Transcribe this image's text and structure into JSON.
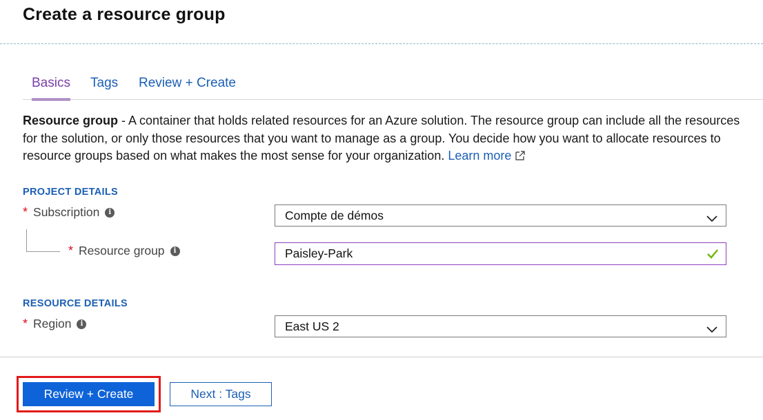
{
  "page": {
    "title": "Create a resource group"
  },
  "tabs": [
    {
      "label": "Basics",
      "active": true
    },
    {
      "label": "Tags",
      "active": false
    },
    {
      "label": "Review + Create",
      "active": false
    }
  ],
  "description": {
    "bold": "Resource group",
    "text": " - A container that holds related resources for an Azure solution. The resource group can include all the resources for the solution, or only those resources that you want to manage as a group. You decide how you want to allocate resources to resource groups based on what makes the most sense for your organization. ",
    "link": "Learn more"
  },
  "project_details": {
    "heading": "PROJECT DETAILS",
    "subscription": {
      "required": "*",
      "label": "Subscription",
      "value": "Compte de démos"
    },
    "resource_group": {
      "required": "*",
      "label": "Resource group",
      "value": "Paisley-Park",
      "valid": true
    }
  },
  "resource_details": {
    "heading": "RESOURCE DETAILS",
    "region": {
      "required": "*",
      "label": "Region",
      "value": "East US 2"
    }
  },
  "footer": {
    "primary_button": "Review + Create",
    "secondary_button": "Next : Tags"
  },
  "icons": {
    "info": "info-icon",
    "external_link": "external-link-icon",
    "dropdown": "chevron-down-icon",
    "valid": "checkmark-icon"
  },
  "colors": {
    "accent_purple": "#7a3fa8",
    "link_blue": "#1b5fb5",
    "primary_button": "#0e63d8",
    "required_red": "#e00b1c",
    "highlight_red": "#e21a1a",
    "check_green": "#6bb700"
  }
}
